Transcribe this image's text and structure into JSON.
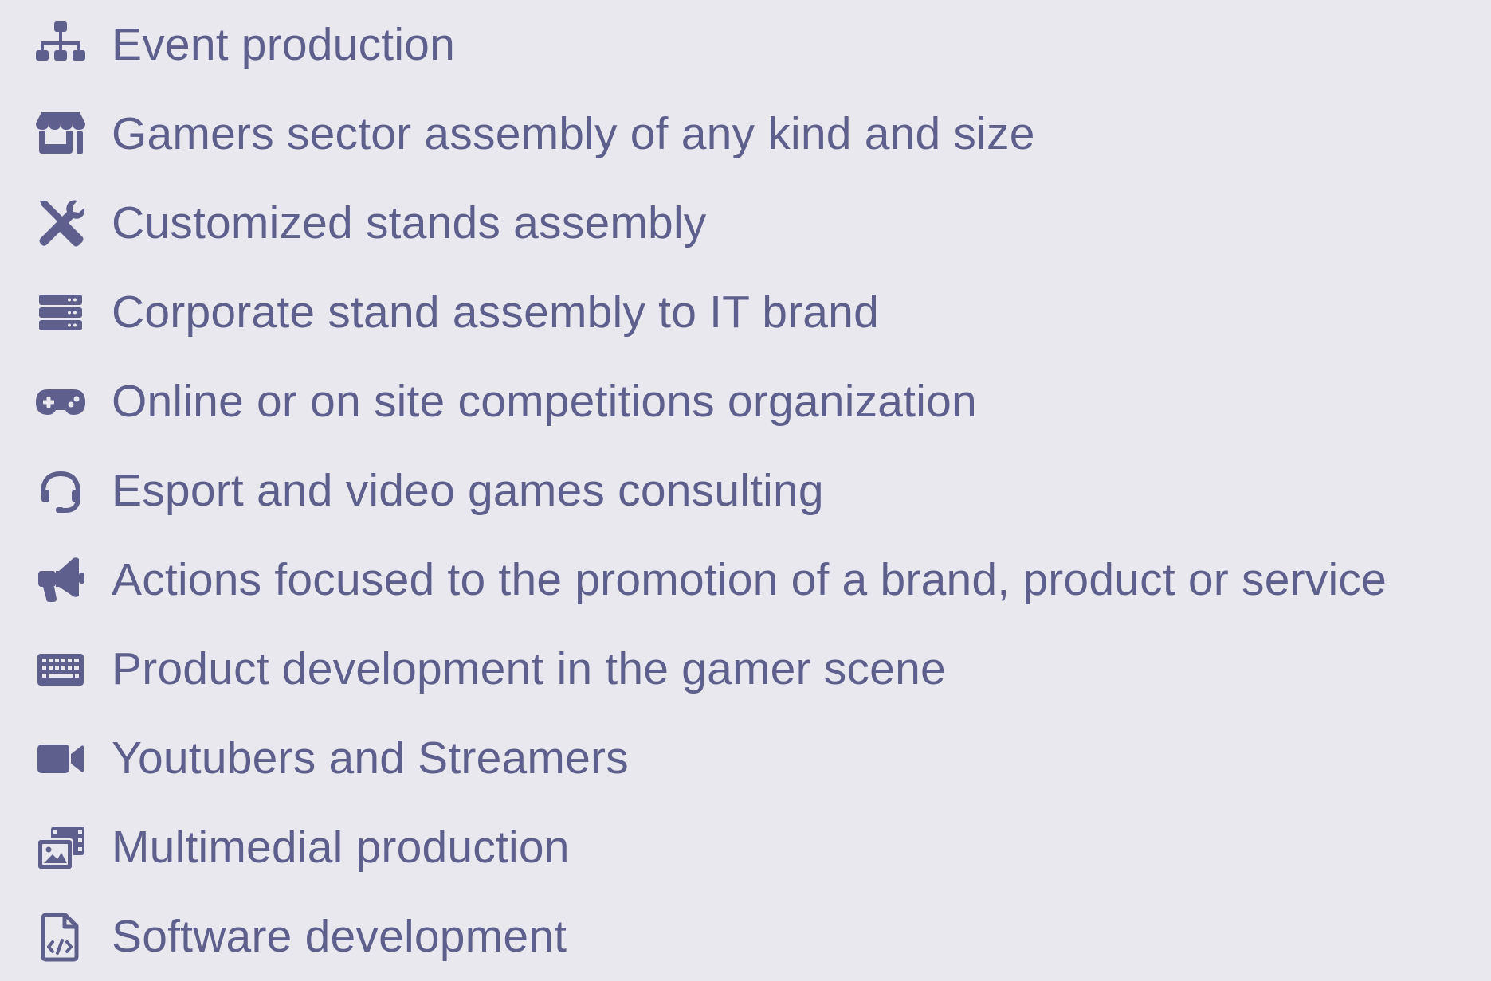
{
  "colors": {
    "background": "#e9e8ee",
    "accent": "#5e5f8c"
  },
  "services": [
    {
      "icon": "sitemap-icon",
      "label": "Event production"
    },
    {
      "icon": "store-icon",
      "label": "Gamers sector assembly of any kind and size"
    },
    {
      "icon": "tools-icon",
      "label": "Customized stands assembly"
    },
    {
      "icon": "server-icon",
      "label": "Corporate stand assembly to IT brand"
    },
    {
      "icon": "gamepad-icon",
      "label": "Online or on site competitions organization"
    },
    {
      "icon": "headset-icon",
      "label": "Esport and video games consulting"
    },
    {
      "icon": "megaphone-icon",
      "label": "Actions focused to the promotion of a brand, product or service"
    },
    {
      "icon": "keyboard-icon",
      "label": "Product development in the gamer scene"
    },
    {
      "icon": "video-camera-icon",
      "label": "Youtubers and Streamers"
    },
    {
      "icon": "photo-film-icon",
      "label": "Multimedial production"
    },
    {
      "icon": "file-code-icon",
      "label": "Software development"
    }
  ]
}
